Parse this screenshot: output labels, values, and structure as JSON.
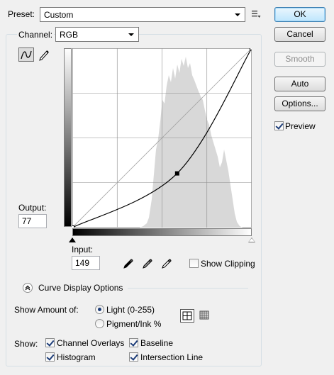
{
  "preset": {
    "label": "Preset:",
    "value": "Custom"
  },
  "buttons": {
    "ok": "OK",
    "cancel": "Cancel",
    "smooth": "Smooth",
    "auto": "Auto",
    "options": "Options..."
  },
  "preview": {
    "label": "Preview",
    "checked": true
  },
  "channel": {
    "label": "Channel:",
    "value": "RGB"
  },
  "output": {
    "label": "Output:",
    "value": "77"
  },
  "input": {
    "label": "Input:",
    "value": "149"
  },
  "show_clipping": {
    "label": "Show Clipping",
    "checked": false
  },
  "curve_display": {
    "label": "Curve Display Options"
  },
  "show_amount": {
    "label": "Show Amount of:",
    "light": "Light  (0-255)",
    "pigment": "Pigment/Ink %",
    "selected": "light"
  },
  "show": {
    "label": "Show:",
    "channel_overlays": "Channel Overlays",
    "baseline": "Baseline",
    "histogram": "Histogram",
    "intersection_line": "Intersection Line"
  },
  "curve": {
    "points": [
      [
        0,
        0
      ],
      [
        149,
        77
      ],
      [
        255,
        255
      ]
    ]
  }
}
